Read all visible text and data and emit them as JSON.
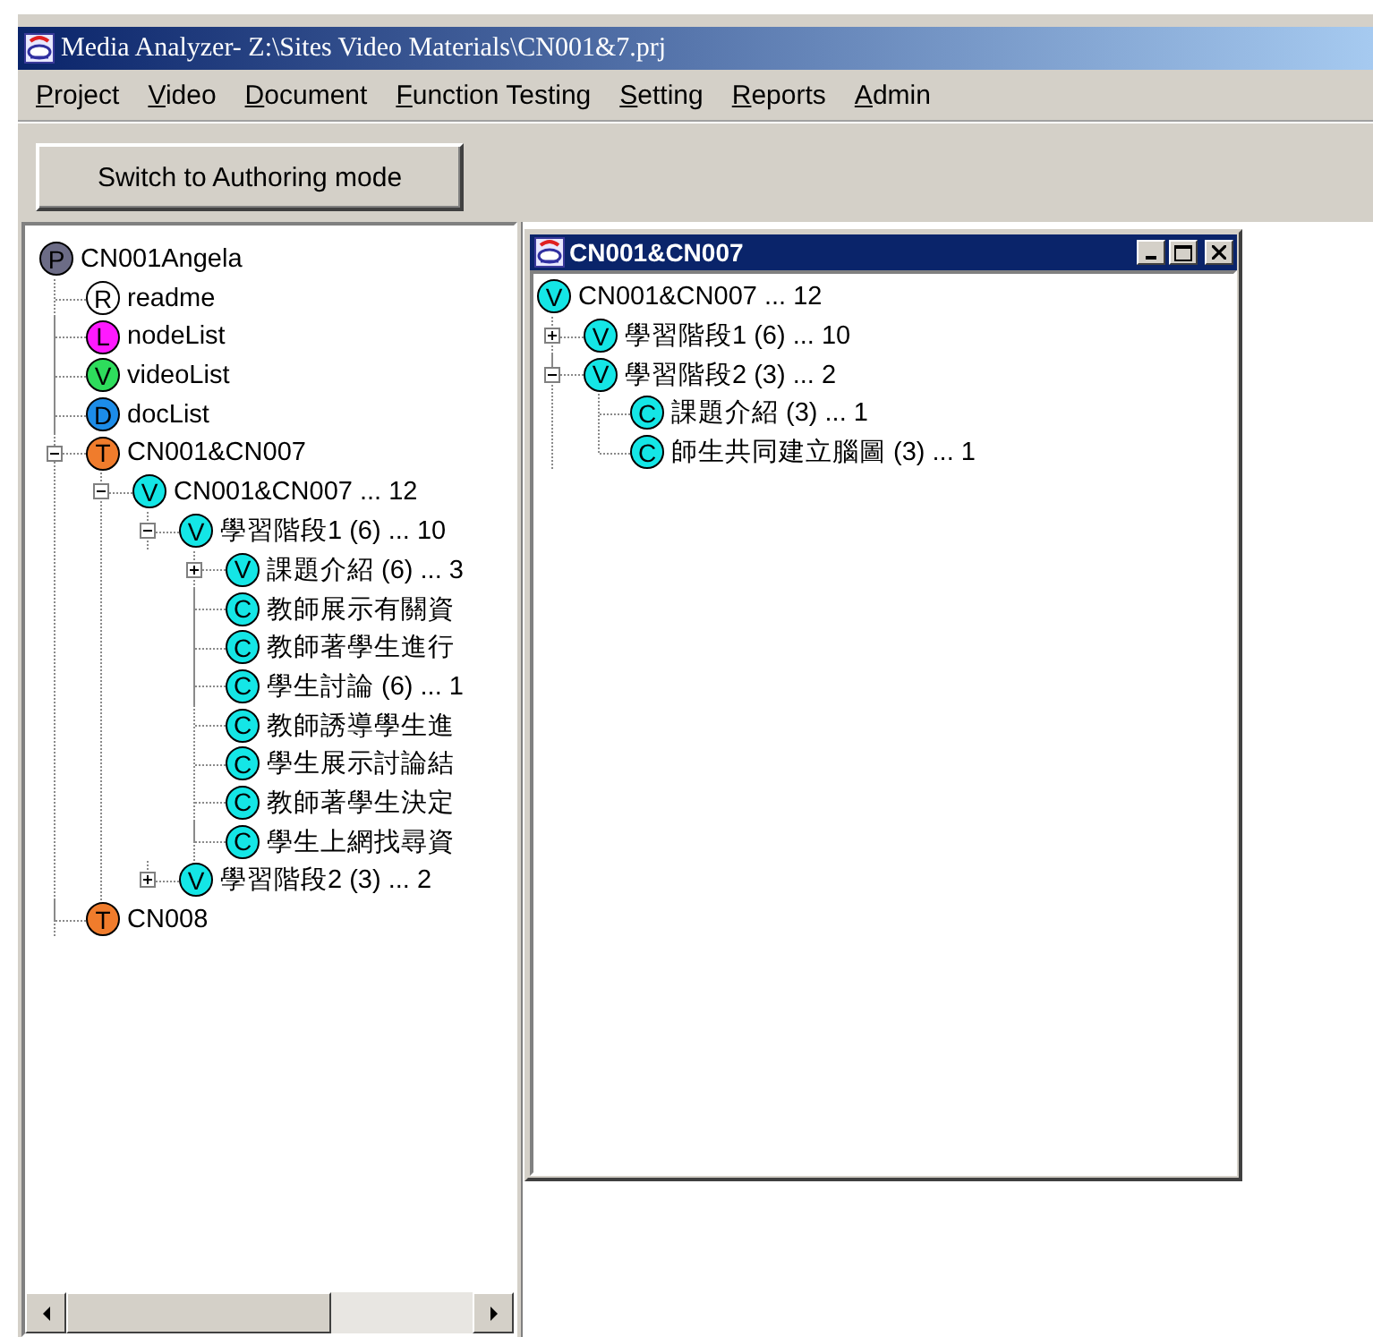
{
  "window": {
    "title": "Media Analyzer- Z:\\Sites Video Materials\\CN001&7.prj"
  },
  "menu": [
    {
      "label": "Project"
    },
    {
      "label": "Video"
    },
    {
      "label": "Document"
    },
    {
      "label": "Function Testing"
    },
    {
      "label": "Setting"
    },
    {
      "label": "Reports"
    },
    {
      "label": "Admin"
    }
  ],
  "toolbar": {
    "button": "Switch to Authoring mode"
  },
  "project_tree": [
    {
      "badge": "P",
      "color": "#6c6c86",
      "label": "CN001Angela",
      "children": [
        {
          "badge": "R",
          "color": "#ffffff",
          "label": "readme"
        },
        {
          "badge": "L",
          "color": "#ff19ff",
          "label": "nodeList"
        },
        {
          "badge": "V",
          "color": "#2edc5c",
          "label": "videoList"
        },
        {
          "badge": "D",
          "color": "#1c8ce8",
          "label": "docList"
        },
        {
          "badge": "T",
          "color": "#f07c2c",
          "label": "CN001&CN007",
          "expanded": true,
          "children": [
            {
              "badge": "V",
              "color": "#14e6e6",
              "label": "CN001&CN007 ... 12",
              "expanded": true,
              "children": [
                {
                  "badge": "V",
                  "color": "#14e6e6",
                  "label": "學習階段1 (6) ... 10",
                  "expanded": true,
                  "children": [
                    {
                      "badge": "V",
                      "color": "#14e6e6",
                      "label": "課題介紹 (6) ... 3",
                      "expanded": false
                    },
                    {
                      "badge": "C",
                      "color": "#14e6e6",
                      "label": "教師展示有關資"
                    },
                    {
                      "badge": "C",
                      "color": "#14e6e6",
                      "label": "教師著學生進行"
                    },
                    {
                      "badge": "C",
                      "color": "#14e6e6",
                      "label": "學生討論 (6) ... 1"
                    },
                    {
                      "badge": "C",
                      "color": "#14e6e6",
                      "label": "教師誘導學生進"
                    },
                    {
                      "badge": "C",
                      "color": "#14e6e6",
                      "label": "學生展示討論結"
                    },
                    {
                      "badge": "C",
                      "color": "#14e6e6",
                      "label": "教師著學生決定"
                    },
                    {
                      "badge": "C",
                      "color": "#14e6e6",
                      "label": "學生上網找尋資"
                    }
                  ]
                },
                {
                  "badge": "V",
                  "color": "#14e6e6",
                  "label": "學習階段2 (3) ... 2",
                  "expanded": false
                }
              ]
            }
          ]
        },
        {
          "badge": "T",
          "color": "#f07c2c",
          "label": "CN008"
        }
      ]
    }
  ],
  "inner_window": {
    "title": "CN001&CN007",
    "tree": [
      {
        "badge": "V",
        "color": "#14e6e6",
        "label": "CN001&CN007 ... 12",
        "children": [
          {
            "badge": "V",
            "color": "#14e6e6",
            "label": "學習階段1 (6) ... 10",
            "expanded": false
          },
          {
            "badge": "V",
            "color": "#14e6e6",
            "label": "學習階段2 (3) ... 2",
            "expanded": true,
            "children": [
              {
                "badge": "C",
                "color": "#14e6e6",
                "label": "課題介紹 (3) ... 1"
              },
              {
                "badge": "C",
                "color": "#14e6e6",
                "label": "師生共同建立腦圖 (3) ... 1"
              }
            ]
          }
        ]
      }
    ]
  }
}
